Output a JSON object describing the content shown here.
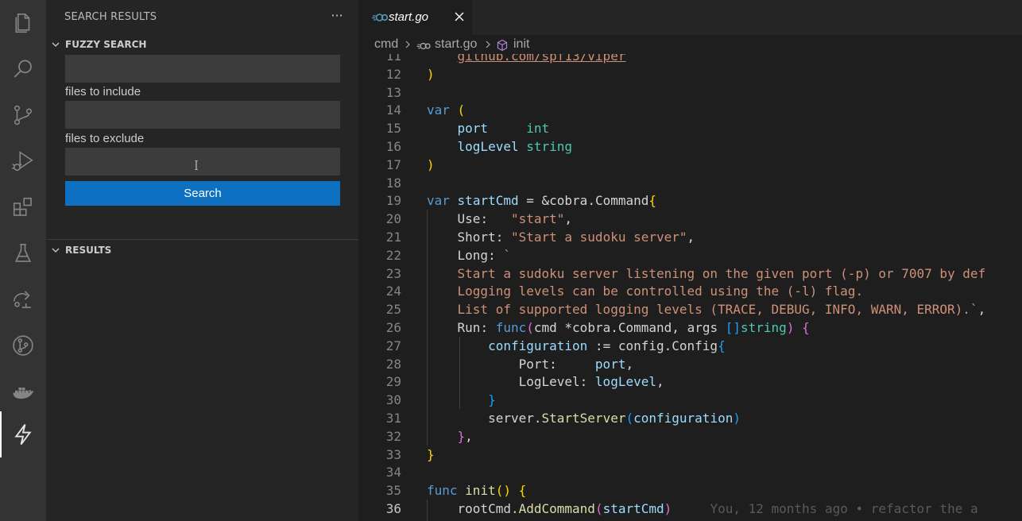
{
  "activity_bar": {
    "items": [
      {
        "name": "explorer-icon"
      },
      {
        "name": "search-icon"
      },
      {
        "name": "source-control-icon"
      },
      {
        "name": "run-debug-icon"
      },
      {
        "name": "extensions-icon"
      },
      {
        "name": "testing-icon"
      },
      {
        "name": "remote-explorer-icon"
      },
      {
        "name": "git-graph-icon"
      },
      {
        "name": "docker-icon"
      },
      {
        "name": "lightning-icon"
      }
    ],
    "active_index": 9
  },
  "sidebar": {
    "title": "SEARCH RESULTS",
    "more_label": "···",
    "fuzzy_section": "FUZZY SEARCH",
    "search_value": "",
    "include_label": "files to include",
    "include_value": "",
    "exclude_label": "files to exclude",
    "exclude_value": "",
    "search_button": "Search",
    "results_section": "RESULTS"
  },
  "editor": {
    "tab_label": "start.go",
    "breadcrumb": [
      "cmd",
      "start.go",
      "init"
    ],
    "current_line": 36,
    "blame": "You, 12 months ago • refactor the a",
    "lines": [
      {
        "n": "11",
        "t": "    github.com/spf13/viper"
      },
      {
        "n": "12",
        "t": ")"
      },
      {
        "n": "13",
        "t": ""
      },
      {
        "n": "14",
        "t": "var ("
      },
      {
        "n": "15",
        "t": "    port     int"
      },
      {
        "n": "16",
        "t": "    logLevel string"
      },
      {
        "n": "17",
        "t": ")"
      },
      {
        "n": "18",
        "t": ""
      },
      {
        "n": "19",
        "t": "var startCmd = &cobra.Command{"
      },
      {
        "n": "20",
        "t": "    Use:   \"start\","
      },
      {
        "n": "21",
        "t": "    Short: \"Start a sudoku server\","
      },
      {
        "n": "22",
        "t": "    Long: `"
      },
      {
        "n": "23",
        "t": "    Start a sudoku server listening on the given port (-p) or 7007 by def"
      },
      {
        "n": "24",
        "t": "    Logging levels can be controlled using the (-l) flag."
      },
      {
        "n": "25",
        "t": "    List of supported logging levels (TRACE, DEBUG, INFO, WARN, ERROR).`,"
      },
      {
        "n": "26",
        "t": "    Run: func(cmd *cobra.Command, args []string) {"
      },
      {
        "n": "27",
        "t": "        configuration := config.Config{"
      },
      {
        "n": "28",
        "t": "            Port:     port,"
      },
      {
        "n": "29",
        "t": "            LogLevel: logLevel,"
      },
      {
        "n": "30",
        "t": "        }"
      },
      {
        "n": "31",
        "t": "        server.StartServer(configuration)"
      },
      {
        "n": "32",
        "t": "    },"
      },
      {
        "n": "33",
        "t": "}"
      },
      {
        "n": "34",
        "t": ""
      },
      {
        "n": "35",
        "t": "func init() {"
      },
      {
        "n": "36",
        "t": "    rootCmd.AddCommand(startCmd)"
      }
    ]
  }
}
